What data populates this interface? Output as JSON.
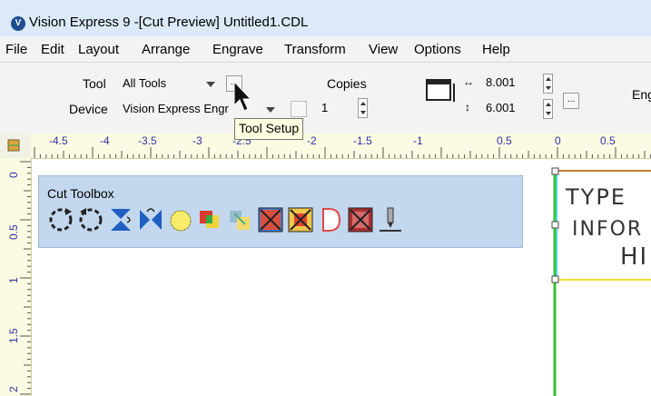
{
  "window": {
    "title": "Vision Express 9 -[Cut Preview] Untitled1.CDL"
  },
  "menu": [
    "File",
    "Edit",
    "Layout",
    "Arrange",
    "Engrave",
    "Transform",
    "View",
    "Options",
    "Help"
  ],
  "toolbar": {
    "tool_label": "Tool",
    "tool_value": "All Tools",
    "device_label": "Device",
    "device_value": "Vision Express Engr",
    "setup_button": "...",
    "copies_label": "Copies",
    "copies_value": "1",
    "width_value": "8.001",
    "height_value": "6.001",
    "size_button": "...",
    "engrave_label_partial": "Eng"
  },
  "tooltip": "Tool Setup",
  "ruler": {
    "horizontal": [
      "-4.5",
      "-4",
      "-3.5",
      "-3",
      "-2.5",
      "-2",
      "-1.5",
      "-1",
      "0.5",
      "0",
      "0.5"
    ],
    "vertical": [
      "0",
      "0.5",
      "1",
      "1.5",
      "2"
    ]
  },
  "toolbox": {
    "title": "Cut Toolbox",
    "tools": [
      "rotate-cw-icon",
      "rotate-ccw-icon",
      "flip-vertical-icon",
      "flip-horizontal-icon",
      "select-icon",
      "overlap-icon",
      "weld-icon",
      "group-icon",
      "delete-node-icon",
      "cancel-icon",
      "d-shape-icon",
      "exclude-icon",
      "tool-depth-icon"
    ]
  },
  "preview": {
    "line1": "TYPE",
    "line2": "INFOR",
    "line3": "HI"
  },
  "colors": {
    "title_bg": "#dbe9f8",
    "toolbox_bg": "#c3d8ee",
    "ruler_bg": "#fbfbe4",
    "tooltip_bg": "#ffffe1",
    "cyan_line": "#4fd0d8",
    "green_line": "#31c631",
    "yellow_line": "#f0e030",
    "brown_line": "#c07a35"
  }
}
